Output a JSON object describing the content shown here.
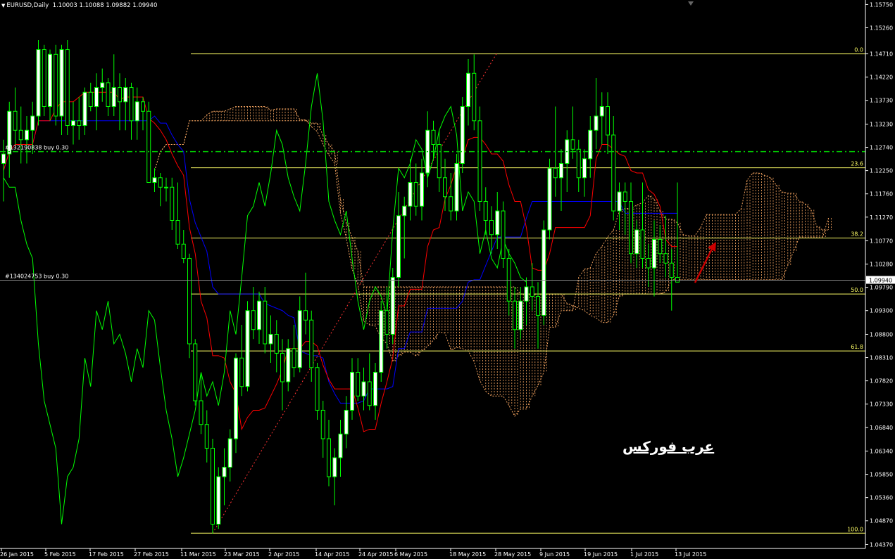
{
  "header": {
    "symbol": "EURUSD,Daily",
    "ohlc": "1.10003 1.10088 1.09882 1.09940"
  },
  "watermark": "عرب فوركس",
  "colors": {
    "background": "#000000",
    "bull_candle": "#ffffff",
    "candle_wick": "#00ff00",
    "kijun": "#0000ff",
    "tenkan": "#ff0000",
    "chikou": "#00ff00",
    "kumo": "#f4a460",
    "fib": "#ffff66",
    "order_line": "#00cc00",
    "arrow": "#cc0000"
  },
  "chart_data": {
    "type": "candlestick",
    "symbol": "EURUSD",
    "timeframe": "Daily",
    "ylim": [
      1.04288,
      1.15845
    ],
    "y_ticks": [
      "1.15750",
      "1.15260",
      "1.14710",
      "1.14220",
      "1.13730",
      "1.13230",
      "1.12740",
      "1.12250",
      "1.11760",
      "1.11270",
      "1.10770",
      "1.10280",
      "1.09790",
      "1.09300",
      "1.08800",
      "1.08310",
      "1.07820",
      "1.07330",
      "1.06840",
      "1.06340",
      "1.05850",
      "1.05360",
      "1.04870",
      "1.04370"
    ],
    "x_labels": [
      "26 Jan 2015",
      "5 Feb 2015",
      "17 Feb 2015",
      "27 Feb 2015",
      "11 Mar 2015",
      "23 Mar 2015",
      "2 Apr 2015",
      "14 Apr 2015",
      "24 Apr 2015",
      "6 May 2015",
      "18 May 2015",
      "28 May 2015",
      "9 Jun 2015",
      "19 Jun 2015",
      "1 Jul 2015",
      "13 Jul 2015"
    ],
    "current_price": "1.09940",
    "fibonacci": [
      {
        "level": "0.0",
        "price": 1.1471
      },
      {
        "level": "23.6",
        "price": 1.1231
      },
      {
        "level": "38.2",
        "price": 1.1083
      },
      {
        "level": "50.0",
        "price": 1.0965
      },
      {
        "level": "61.8",
        "price": 1.0845
      },
      {
        "level": "100.0",
        "price": 1.0461
      }
    ],
    "orders": [
      {
        "label": "#132190838 buy 0.30",
        "price": 1.1265
      },
      {
        "label": "#134024753 buy 0.30",
        "price": 1.0994
      }
    ],
    "candles": [
      [
        1.124,
        1.129,
        1.116,
        1.126
      ],
      [
        1.126,
        1.137,
        1.121,
        1.135
      ],
      [
        1.135,
        1.14,
        1.128,
        1.131
      ],
      [
        1.131,
        1.136,
        1.124,
        1.129
      ],
      [
        1.129,
        1.134,
        1.124,
        1.131
      ],
      [
        1.131,
        1.137,
        1.126,
        1.134
      ],
      [
        1.134,
        1.15,
        1.132,
        1.148
      ],
      [
        1.148,
        1.149,
        1.134,
        1.136
      ],
      [
        1.136,
        1.148,
        1.133,
        1.147
      ],
      [
        1.147,
        1.149,
        1.132,
        1.134
      ],
      [
        1.134,
        1.149,
        1.13,
        1.148
      ],
      [
        1.148,
        1.15,
        1.13,
        1.132
      ],
      [
        1.132,
        1.137,
        1.128,
        1.133
      ],
      [
        1.133,
        1.138,
        1.129,
        1.132
      ],
      [
        1.132,
        1.14,
        1.13,
        1.139
      ],
      [
        1.139,
        1.141,
        1.135,
        1.136
      ],
      [
        1.136,
        1.143,
        1.131,
        1.14
      ],
      [
        1.14,
        1.144,
        1.137,
        1.141
      ],
      [
        1.141,
        1.142,
        1.134,
        1.136
      ],
      [
        1.136,
        1.147,
        1.134,
        1.14
      ],
      [
        1.14,
        1.143,
        1.131,
        1.137
      ],
      [
        1.137,
        1.142,
        1.131,
        1.14
      ],
      [
        1.14,
        1.141,
        1.129,
        1.133
      ],
      [
        1.133,
        1.14,
        1.129,
        1.137
      ],
      [
        1.137,
        1.138,
        1.131,
        1.135
      ],
      [
        1.135,
        1.137,
        1.12,
        1.12
      ],
      [
        1.12,
        1.123,
        1.118,
        1.121
      ],
      [
        1.121,
        1.122,
        1.115,
        1.119
      ],
      [
        1.119,
        1.121,
        1.116,
        1.119
      ],
      [
        1.119,
        1.121,
        1.11,
        1.112
      ],
      [
        1.112,
        1.12,
        1.106,
        1.107
      ],
      [
        1.107,
        1.11,
        1.103,
        1.104
      ],
      [
        1.104,
        1.105,
        1.083,
        1.086
      ],
      [
        1.086,
        1.087,
        1.073,
        1.074
      ],
      [
        1.074,
        1.08,
        1.067,
        1.069
      ],
      [
        1.069,
        1.072,
        1.061,
        1.064
      ],
      [
        1.064,
        1.066,
        1.046,
        1.048
      ],
      [
        1.048,
        1.06,
        1.047,
        1.058
      ],
      [
        1.058,
        1.064,
        1.052,
        1.06
      ],
      [
        1.06,
        1.068,
        1.057,
        1.066
      ],
      [
        1.066,
        1.084,
        1.063,
        1.083
      ],
      [
        1.083,
        1.09,
        1.075,
        1.077
      ],
      [
        1.077,
        1.095,
        1.076,
        1.093
      ],
      [
        1.093,
        1.098,
        1.087,
        1.089
      ],
      [
        1.089,
        1.097,
        1.086,
        1.095
      ],
      [
        1.095,
        1.098,
        1.084,
        1.086
      ],
      [
        1.086,
        1.092,
        1.082,
        1.088
      ],
      [
        1.088,
        1.091,
        1.08,
        1.084
      ],
      [
        1.084,
        1.087,
        1.072,
        1.078
      ],
      [
        1.078,
        1.087,
        1.076,
        1.085
      ],
      [
        1.085,
        1.09,
        1.079,
        1.081
      ],
      [
        1.081,
        1.096,
        1.08,
        1.093
      ],
      [
        1.093,
        1.101,
        1.088,
        1.091
      ],
      [
        1.091,
        1.093,
        1.078,
        1.081
      ],
      [
        1.081,
        1.082,
        1.07,
        1.072
      ],
      [
        1.072,
        1.074,
        1.062,
        1.066
      ],
      [
        1.066,
        1.07,
        1.056,
        1.058
      ],
      [
        1.058,
        1.064,
        1.052,
        1.062
      ],
      [
        1.062,
        1.07,
        1.058,
        1.067
      ],
      [
        1.067,
        1.075,
        1.064,
        1.072
      ],
      [
        1.072,
        1.083,
        1.07,
        1.08
      ],
      [
        1.08,
        1.083,
        1.074,
        1.075
      ],
      [
        1.075,
        1.081,
        1.072,
        1.078
      ],
      [
        1.078,
        1.084,
        1.072,
        1.073
      ],
      [
        1.073,
        1.082,
        1.07,
        1.08
      ],
      [
        1.08,
        1.095,
        1.078,
        1.093
      ],
      [
        1.093,
        1.098,
        1.085,
        1.088
      ],
      [
        1.088,
        1.102,
        1.086,
        1.1
      ],
      [
        1.1,
        1.118,
        1.098,
        1.113
      ],
      [
        1.113,
        1.117,
        1.104,
        1.115
      ],
      [
        1.115,
        1.125,
        1.112,
        1.12
      ],
      [
        1.12,
        1.124,
        1.113,
        1.115
      ],
      [
        1.115,
        1.125,
        1.112,
        1.122
      ],
      [
        1.122,
        1.135,
        1.119,
        1.131
      ],
      [
        1.131,
        1.133,
        1.125,
        1.128
      ],
      [
        1.128,
        1.131,
        1.118,
        1.121
      ],
      [
        1.121,
        1.125,
        1.114,
        1.117
      ],
      [
        1.117,
        1.122,
        1.112,
        1.114
      ],
      [
        1.114,
        1.126,
        1.112,
        1.124
      ],
      [
        1.124,
        1.138,
        1.122,
        1.136
      ],
      [
        1.136,
        1.146,
        1.132,
        1.143
      ],
      [
        1.143,
        1.147,
        1.131,
        1.133
      ],
      [
        1.133,
        1.136,
        1.114,
        1.116
      ],
      [
        1.116,
        1.119,
        1.109,
        1.112
      ],
      [
        1.112,
        1.115,
        1.105,
        1.109
      ],
      [
        1.109,
        1.118,
        1.106,
        1.114
      ],
      [
        1.114,
        1.116,
        1.102,
        1.104
      ],
      [
        1.104,
        1.106,
        1.092,
        1.095
      ],
      [
        1.095,
        1.098,
        1.085,
        1.089
      ],
      [
        1.089,
        1.098,
        1.087,
        1.095
      ],
      [
        1.095,
        1.1,
        1.09,
        1.098
      ],
      [
        1.098,
        1.103,
        1.093,
        1.096
      ],
      [
        1.096,
        1.099,
        1.085,
        1.092
      ],
      [
        1.092,
        1.112,
        1.09,
        1.11
      ],
      [
        1.11,
        1.125,
        1.108,
        1.123
      ],
      [
        1.123,
        1.136,
        1.117,
        1.121
      ],
      [
        1.121,
        1.127,
        1.114,
        1.124
      ],
      [
        1.124,
        1.131,
        1.118,
        1.129
      ],
      [
        1.129,
        1.136,
        1.125,
        1.127
      ],
      [
        1.127,
        1.129,
        1.118,
        1.121
      ],
      [
        1.121,
        1.127,
        1.117,
        1.125
      ],
      [
        1.125,
        1.134,
        1.121,
        1.131
      ],
      [
        1.131,
        1.142,
        1.127,
        1.134
      ],
      [
        1.134,
        1.139,
        1.128,
        1.136
      ],
      [
        1.136,
        1.139,
        1.126,
        1.13
      ],
      [
        1.13,
        1.134,
        1.112,
        1.114
      ],
      [
        1.114,
        1.12,
        1.11,
        1.118
      ],
      [
        1.118,
        1.12,
        1.109,
        1.116
      ],
      [
        1.116,
        1.12,
        1.103,
        1.105
      ],
      [
        1.105,
        1.112,
        1.102,
        1.11
      ],
      [
        1.11,
        1.12,
        1.102,
        1.104
      ],
      [
        1.104,
        1.107,
        1.098,
        1.102
      ],
      [
        1.102,
        1.112,
        1.096,
        1.108
      ],
      [
        1.108,
        1.111,
        1.103,
        1.105
      ],
      [
        1.105,
        1.113,
        1.1,
        1.103
      ],
      [
        1.103,
        1.106,
        1.093,
        1.1
      ],
      [
        1.1,
        1.12,
        1.099,
        1.099
      ]
    ]
  }
}
